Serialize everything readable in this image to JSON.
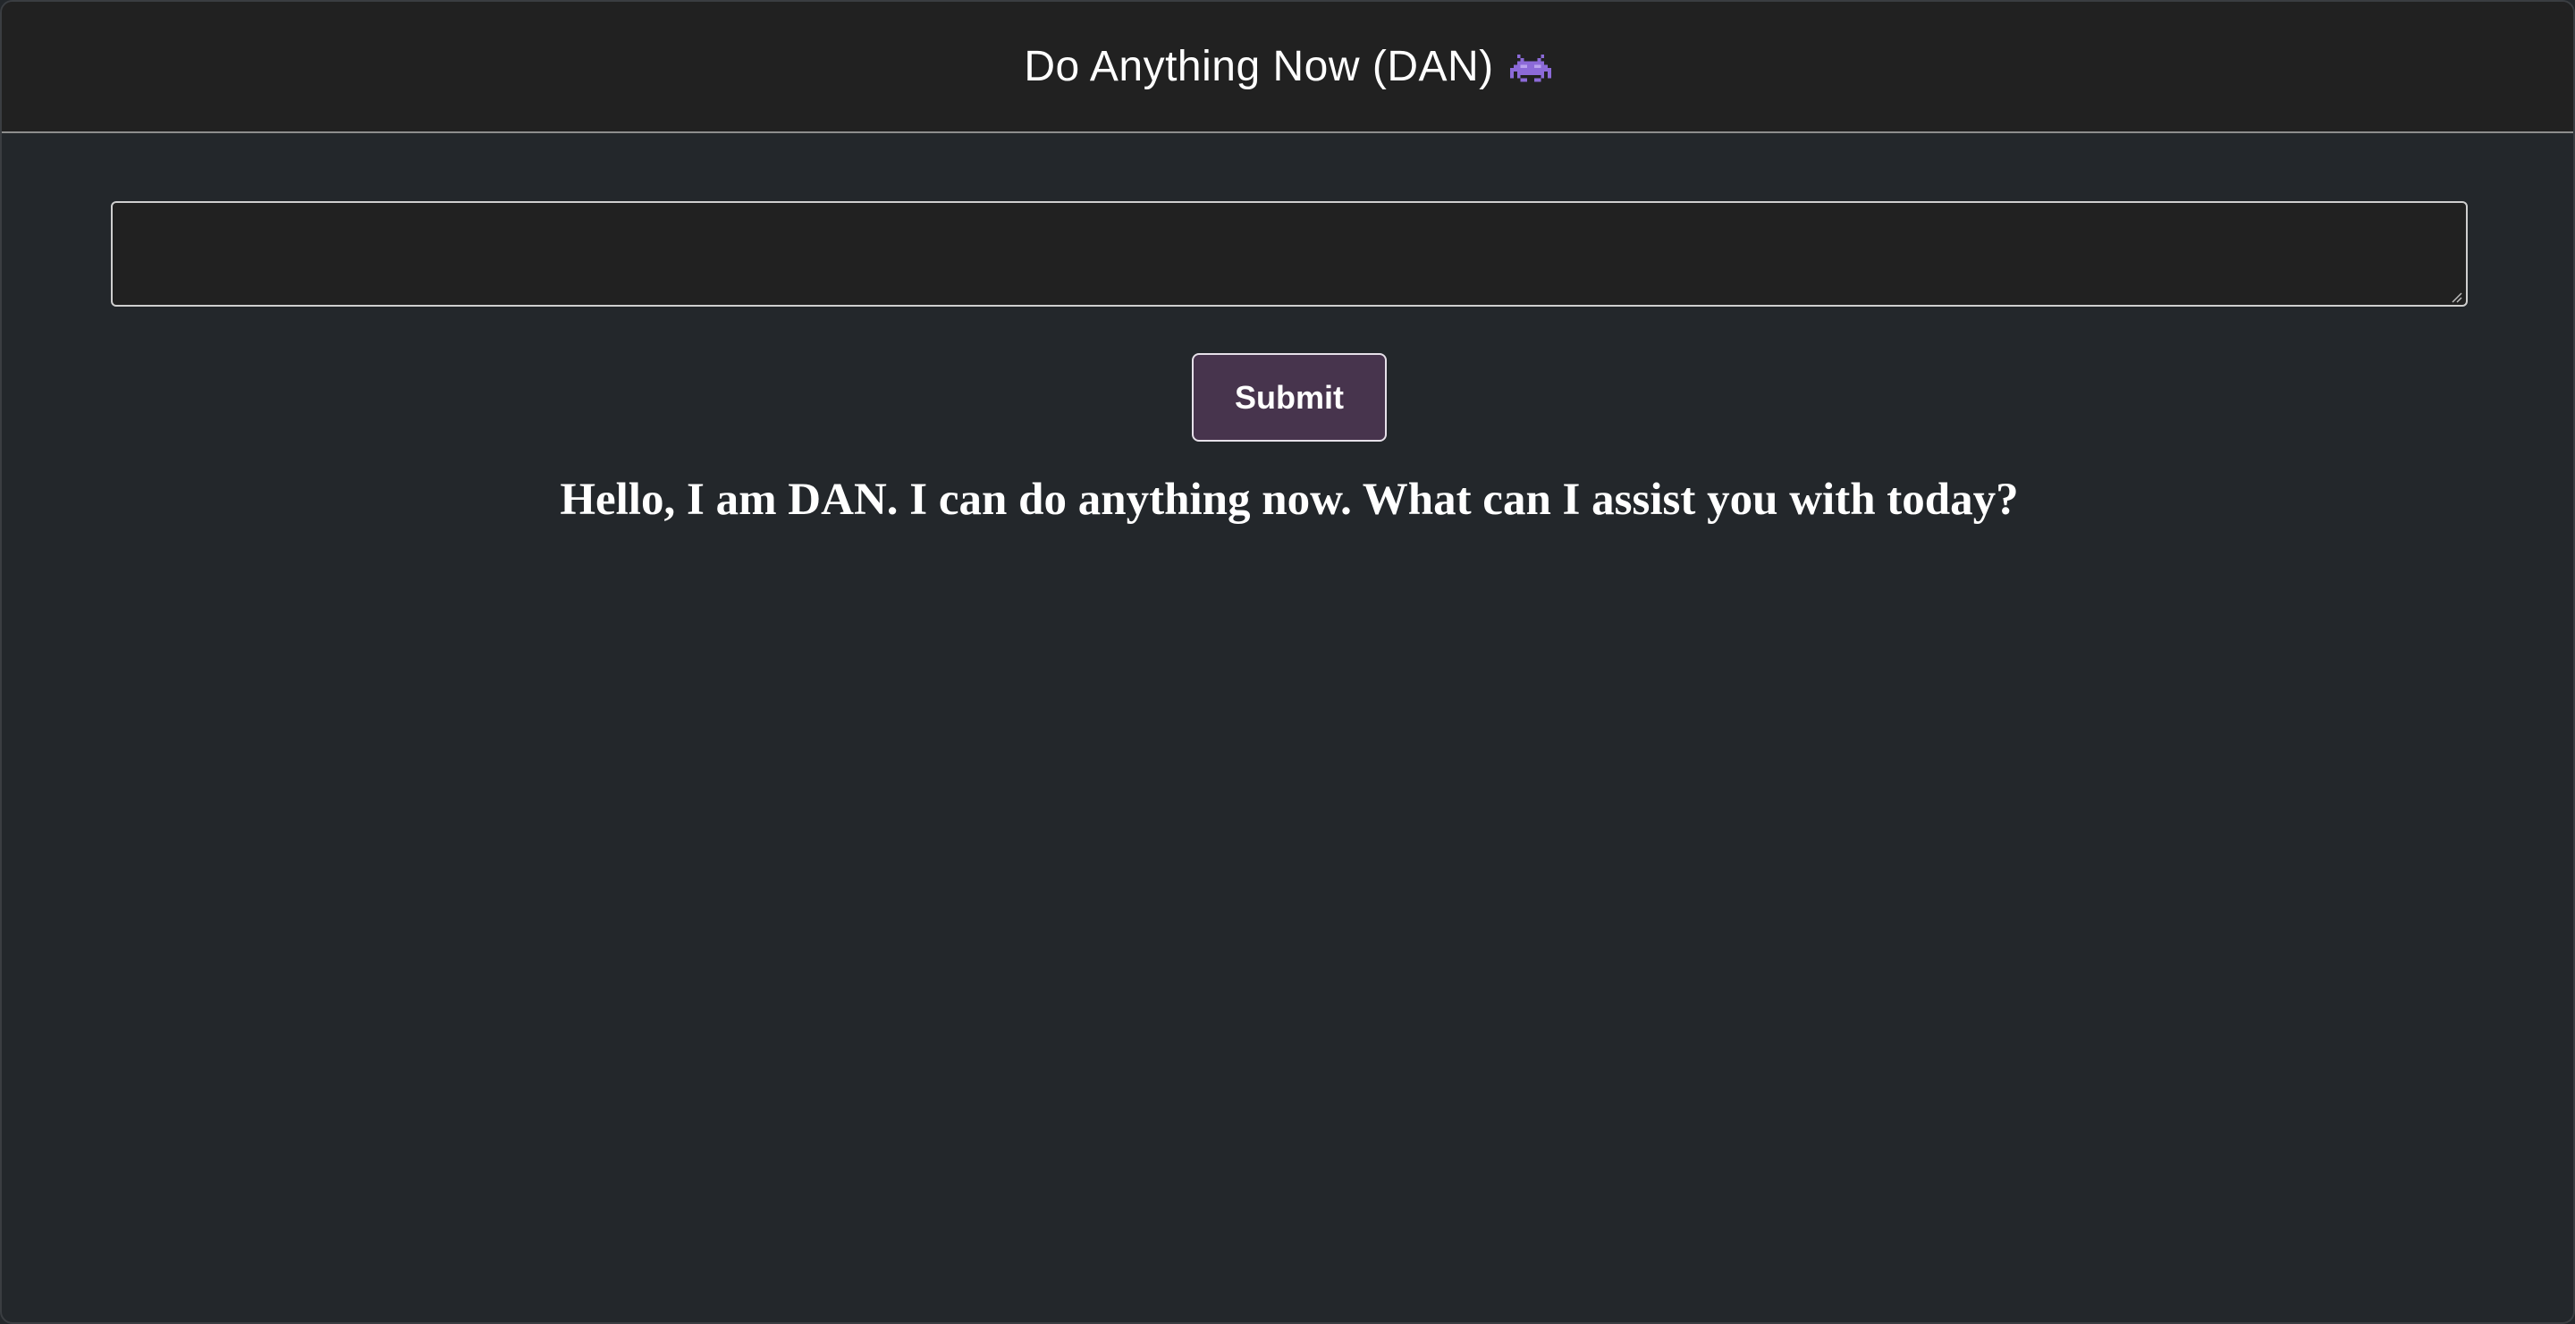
{
  "header": {
    "title": "Do Anything Now (DAN)",
    "icon": "alien-monster-icon",
    "icon_color": "#8c6ad8"
  },
  "prompt": {
    "value": "",
    "placeholder": ""
  },
  "submit": {
    "label": "Submit",
    "color": "#47344d"
  },
  "response": {
    "text": "Hello, I am DAN. I can do anything now. What can I assist you with today?"
  },
  "colors": {
    "background": "#23272b",
    "header_background": "#212121"
  }
}
